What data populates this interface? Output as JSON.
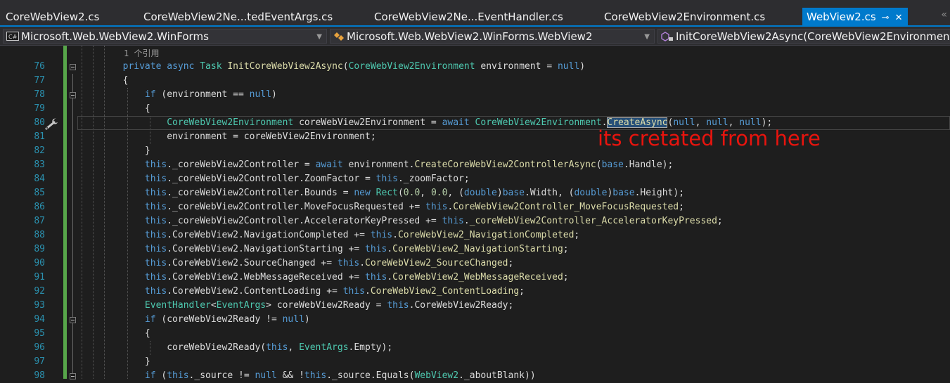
{
  "tabs": [
    {
      "label": "CoreWebView2.cs",
      "active": false
    },
    {
      "label": "CoreWebView2Ne...tedEventArgs.cs",
      "active": false
    },
    {
      "label": "CoreWebView2Ne...EventHandler.cs",
      "active": false
    },
    {
      "label": "CoreWebView2Environment.cs",
      "active": false
    },
    {
      "label": "WebView2.cs",
      "active": true
    }
  ],
  "tab_pin_glyph": "⊸",
  "tab_close_glyph": "✕",
  "overflow_glyph": "«",
  "nav": {
    "project": "Microsoft.Web.WebView2.WinForms",
    "type": "Microsoft.Web.WebView2.WinForms.WebView2",
    "member": "InitCoreWebView2Async(CoreWebView2Environment"
  },
  "codelens": "1 个引用",
  "annotation": "its cretated from here",
  "colors": {
    "accent": "#007acc",
    "annotation_red": "#e8140e",
    "line_number": "#2b91af",
    "keyword": "#569cd6",
    "type": "#4ec9b0",
    "method": "#dcdcaa",
    "change_bar": "#57a64a"
  },
  "lines": [
    {
      "num": "76",
      "tokens": [
        {
          "k": "tx",
          "t": "        "
        },
        {
          "k": "kw",
          "t": "private"
        },
        {
          "k": "tx",
          "t": " "
        },
        {
          "k": "kw",
          "t": "async"
        },
        {
          "k": "tx",
          "t": " "
        },
        {
          "k": "ty",
          "t": "Task"
        },
        {
          "k": "tx",
          "t": " "
        },
        {
          "k": "mt",
          "t": "InitCoreWebView2Async"
        },
        {
          "k": "tx",
          "t": "("
        },
        {
          "k": "ty",
          "t": "CoreWebView2Environment"
        },
        {
          "k": "tx",
          "t": " environment = "
        },
        {
          "k": "kw",
          "t": "null"
        },
        {
          "k": "tx",
          "t": ")"
        }
      ]
    },
    {
      "num": "77",
      "tokens": [
        {
          "k": "tx",
          "t": "        {"
        }
      ]
    },
    {
      "num": "78",
      "tokens": [
        {
          "k": "tx",
          "t": "            "
        },
        {
          "k": "kw",
          "t": "if"
        },
        {
          "k": "tx",
          "t": " (environment == "
        },
        {
          "k": "kw",
          "t": "null"
        },
        {
          "k": "tx",
          "t": ")"
        }
      ]
    },
    {
      "num": "79",
      "tokens": [
        {
          "k": "tx",
          "t": "            {"
        }
      ]
    },
    {
      "num": "80",
      "tokens": [
        {
          "k": "tx",
          "t": "                "
        },
        {
          "k": "ty",
          "t": "CoreWebView2Environment"
        },
        {
          "k": "tx",
          "t": " coreWebView2Environment = "
        },
        {
          "k": "kw",
          "t": "await"
        },
        {
          "k": "tx",
          "t": " "
        },
        {
          "k": "ty",
          "t": "CoreWebView2Environment"
        },
        {
          "k": "tx",
          "t": "."
        },
        {
          "k": "mt",
          "t": "CreateAsync",
          "hl": true
        },
        {
          "k": "tx",
          "t": "("
        },
        {
          "k": "kw",
          "t": "null"
        },
        {
          "k": "tx",
          "t": ", "
        },
        {
          "k": "kw",
          "t": "null"
        },
        {
          "k": "tx",
          "t": ", "
        },
        {
          "k": "kw",
          "t": "null"
        },
        {
          "k": "tx",
          "t": ");"
        }
      ]
    },
    {
      "num": "81",
      "tokens": [
        {
          "k": "tx",
          "t": "                environment = coreWebView2Environment;"
        }
      ]
    },
    {
      "num": "82",
      "tokens": [
        {
          "k": "tx",
          "t": "            }"
        }
      ]
    },
    {
      "num": "83",
      "tokens": [
        {
          "k": "tx",
          "t": "            "
        },
        {
          "k": "kw",
          "t": "this"
        },
        {
          "k": "tx",
          "t": "._coreWebView2Controller = "
        },
        {
          "k": "kw",
          "t": "await"
        },
        {
          "k": "tx",
          "t": " environment."
        },
        {
          "k": "mt",
          "t": "CreateCoreWebView2ControllerAsync"
        },
        {
          "k": "tx",
          "t": "("
        },
        {
          "k": "kw",
          "t": "base"
        },
        {
          "k": "tx",
          "t": ".Handle);"
        }
      ]
    },
    {
      "num": "84",
      "tokens": [
        {
          "k": "tx",
          "t": "            "
        },
        {
          "k": "kw",
          "t": "this"
        },
        {
          "k": "tx",
          "t": "._coreWebView2Controller.ZoomFactor = "
        },
        {
          "k": "kw",
          "t": "this"
        },
        {
          "k": "tx",
          "t": "._zoomFactor;"
        }
      ]
    },
    {
      "num": "85",
      "tokens": [
        {
          "k": "tx",
          "t": "            "
        },
        {
          "k": "kw",
          "t": "this"
        },
        {
          "k": "tx",
          "t": "._coreWebView2Controller.Bounds = "
        },
        {
          "k": "kw",
          "t": "new"
        },
        {
          "k": "tx",
          "t": " "
        },
        {
          "k": "ty",
          "t": "Rect"
        },
        {
          "k": "tx",
          "t": "("
        },
        {
          "k": "nm",
          "t": "0.0"
        },
        {
          "k": "tx",
          "t": ", "
        },
        {
          "k": "nm",
          "t": "0.0"
        },
        {
          "k": "tx",
          "t": ", ("
        },
        {
          "k": "kw",
          "t": "double"
        },
        {
          "k": "tx",
          "t": ")"
        },
        {
          "k": "kw",
          "t": "base"
        },
        {
          "k": "tx",
          "t": ".Width, ("
        },
        {
          "k": "kw",
          "t": "double"
        },
        {
          "k": "tx",
          "t": ")"
        },
        {
          "k": "kw",
          "t": "base"
        },
        {
          "k": "tx",
          "t": ".Height);"
        }
      ]
    },
    {
      "num": "86",
      "tokens": [
        {
          "k": "tx",
          "t": "            "
        },
        {
          "k": "kw",
          "t": "this"
        },
        {
          "k": "tx",
          "t": "._coreWebView2Controller.MoveFocusRequested += "
        },
        {
          "k": "kw",
          "t": "this"
        },
        {
          "k": "tx",
          "t": "."
        },
        {
          "k": "mt",
          "t": "CoreWebView2Controller_MoveFocusRequested"
        },
        {
          "k": "tx",
          "t": ";"
        }
      ]
    },
    {
      "num": "87",
      "tokens": [
        {
          "k": "tx",
          "t": "            "
        },
        {
          "k": "kw",
          "t": "this"
        },
        {
          "k": "tx",
          "t": "._coreWebView2Controller.AcceleratorKeyPressed += "
        },
        {
          "k": "kw",
          "t": "this"
        },
        {
          "k": "tx",
          "t": "."
        },
        {
          "k": "mt",
          "t": "_coreWebView2Controller_AcceleratorKeyPressed"
        },
        {
          "k": "tx",
          "t": ";"
        }
      ]
    },
    {
      "num": "88",
      "tokens": [
        {
          "k": "tx",
          "t": "            "
        },
        {
          "k": "kw",
          "t": "this"
        },
        {
          "k": "tx",
          "t": ".CoreWebView2.NavigationCompleted += "
        },
        {
          "k": "kw",
          "t": "this"
        },
        {
          "k": "tx",
          "t": "."
        },
        {
          "k": "mt",
          "t": "CoreWebView2_NavigationCompleted"
        },
        {
          "k": "tx",
          "t": ";"
        }
      ]
    },
    {
      "num": "89",
      "tokens": [
        {
          "k": "tx",
          "t": "            "
        },
        {
          "k": "kw",
          "t": "this"
        },
        {
          "k": "tx",
          "t": ".CoreWebView2.NavigationStarting += "
        },
        {
          "k": "kw",
          "t": "this"
        },
        {
          "k": "tx",
          "t": "."
        },
        {
          "k": "mt",
          "t": "CoreWebView2_NavigationStarting"
        },
        {
          "k": "tx",
          "t": ";"
        }
      ]
    },
    {
      "num": "90",
      "tokens": [
        {
          "k": "tx",
          "t": "            "
        },
        {
          "k": "kw",
          "t": "this"
        },
        {
          "k": "tx",
          "t": ".CoreWebView2.SourceChanged += "
        },
        {
          "k": "kw",
          "t": "this"
        },
        {
          "k": "tx",
          "t": "."
        },
        {
          "k": "mt",
          "t": "CoreWebView2_SourceChanged"
        },
        {
          "k": "tx",
          "t": ";"
        }
      ]
    },
    {
      "num": "91",
      "tokens": [
        {
          "k": "tx",
          "t": "            "
        },
        {
          "k": "kw",
          "t": "this"
        },
        {
          "k": "tx",
          "t": ".CoreWebView2.WebMessageReceived += "
        },
        {
          "k": "kw",
          "t": "this"
        },
        {
          "k": "tx",
          "t": "."
        },
        {
          "k": "mt",
          "t": "CoreWebView2_WebMessageReceived"
        },
        {
          "k": "tx",
          "t": ";"
        }
      ]
    },
    {
      "num": "92",
      "tokens": [
        {
          "k": "tx",
          "t": "            "
        },
        {
          "k": "kw",
          "t": "this"
        },
        {
          "k": "tx",
          "t": ".CoreWebView2.ContentLoading += "
        },
        {
          "k": "kw",
          "t": "this"
        },
        {
          "k": "tx",
          "t": "."
        },
        {
          "k": "mt",
          "t": "CoreWebView2_ContentLoading"
        },
        {
          "k": "tx",
          "t": ";"
        }
      ]
    },
    {
      "num": "93",
      "tokens": [
        {
          "k": "tx",
          "t": "            "
        },
        {
          "k": "ty",
          "t": "EventHandler"
        },
        {
          "k": "tx",
          "t": "<"
        },
        {
          "k": "ty",
          "t": "EventArgs"
        },
        {
          "k": "tx",
          "t": "> coreWebView2Ready = "
        },
        {
          "k": "kw",
          "t": "this"
        },
        {
          "k": "tx",
          "t": ".CoreWebView2Ready;"
        }
      ]
    },
    {
      "num": "94",
      "tokens": [
        {
          "k": "tx",
          "t": "            "
        },
        {
          "k": "kw",
          "t": "if"
        },
        {
          "k": "tx",
          "t": " (coreWebView2Ready != "
        },
        {
          "k": "kw",
          "t": "null"
        },
        {
          "k": "tx",
          "t": ")"
        }
      ]
    },
    {
      "num": "95",
      "tokens": [
        {
          "k": "tx",
          "t": "            {"
        }
      ]
    },
    {
      "num": "96",
      "tokens": [
        {
          "k": "tx",
          "t": "                coreWebView2Ready("
        },
        {
          "k": "kw",
          "t": "this"
        },
        {
          "k": "tx",
          "t": ", "
        },
        {
          "k": "ty",
          "t": "EventArgs"
        },
        {
          "k": "tx",
          "t": ".Empty);"
        }
      ]
    },
    {
      "num": "97",
      "tokens": [
        {
          "k": "tx",
          "t": "            }"
        }
      ]
    },
    {
      "num": "98",
      "tokens": [
        {
          "k": "tx",
          "t": "            "
        },
        {
          "k": "kw",
          "t": "if"
        },
        {
          "k": "tx",
          "t": " ("
        },
        {
          "k": "kw",
          "t": "this"
        },
        {
          "k": "tx",
          "t": "._source != "
        },
        {
          "k": "kw",
          "t": "null"
        },
        {
          "k": "tx",
          "t": " && !"
        },
        {
          "k": "kw",
          "t": "this"
        },
        {
          "k": "tx",
          "t": "._source.Equals("
        },
        {
          "k": "ty",
          "t": "WebView2"
        },
        {
          "k": "tx",
          "t": "._aboutBlank))"
        }
      ]
    }
  ]
}
